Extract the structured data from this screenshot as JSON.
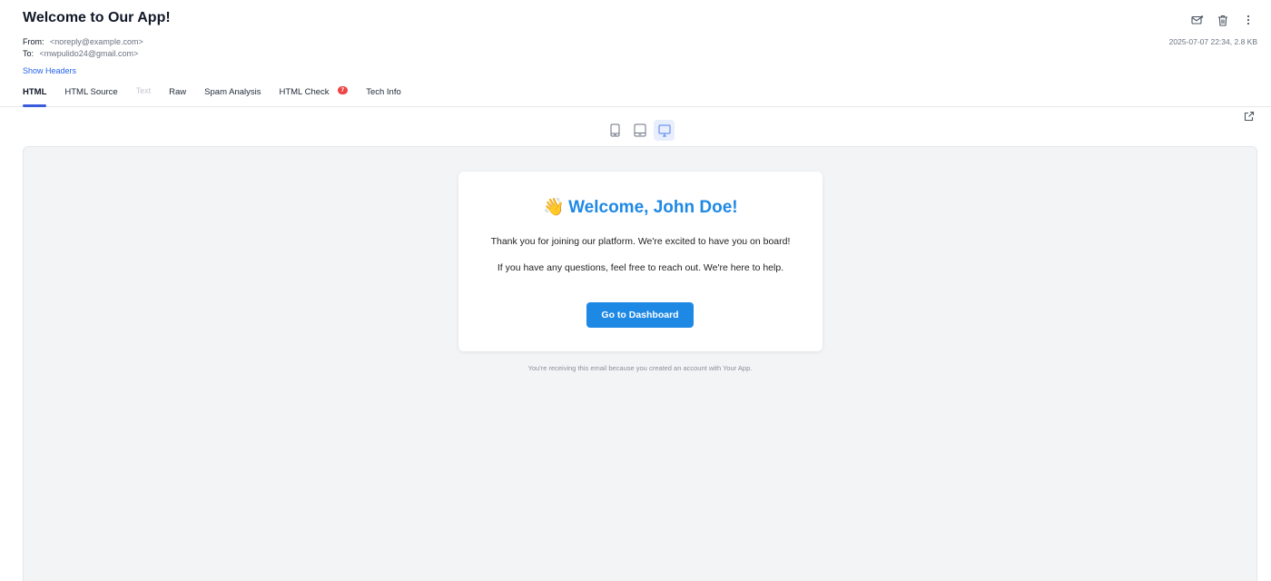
{
  "email": {
    "subject": "Welcome to Our App!",
    "from_label": "From:",
    "from_address": "<noreply@example.com>",
    "to_label": "To:",
    "to_address": "<mwpulido24@gmail.com>",
    "show_headers": "Show Headers",
    "meta": "2025-07-07 22:34, 2.8 KB"
  },
  "actions": [
    {
      "icon": "mark-unread-icon"
    },
    {
      "icon": "trash-icon"
    },
    {
      "icon": "more-vertical-icon"
    }
  ],
  "tabs": [
    {
      "label": "HTML",
      "state": "active"
    },
    {
      "label": "HTML Source",
      "state": "normal"
    },
    {
      "label": "Text",
      "state": "disabled"
    },
    {
      "label": "Raw",
      "state": "normal"
    },
    {
      "label": "Spam Analysis",
      "state": "normal"
    },
    {
      "label": "HTML Check",
      "state": "normal",
      "badge": "7"
    },
    {
      "label": "Tech Info",
      "state": "normal"
    }
  ],
  "devices": {
    "options": [
      "phone-icon",
      "tablet-icon",
      "desktop-icon"
    ],
    "selected": "desktop-icon"
  },
  "preview": {
    "wave_emoji": "👋",
    "title": "Welcome, John Doe!",
    "paragraph1": "Thank you for joining our platform. We're excited to have you on board!",
    "paragraph2": "If you have any questions, feel free to reach out. We're here to help.",
    "button_label": "Go to Dashboard",
    "footer": "You're receiving this email because you created an account with Your App."
  },
  "colors": {
    "accent": "#1e88e5",
    "tab_indicator": "#3b5bdb",
    "badge": "#ef4444",
    "link": "#2563eb",
    "preview_bg": "#f3f4f6"
  }
}
